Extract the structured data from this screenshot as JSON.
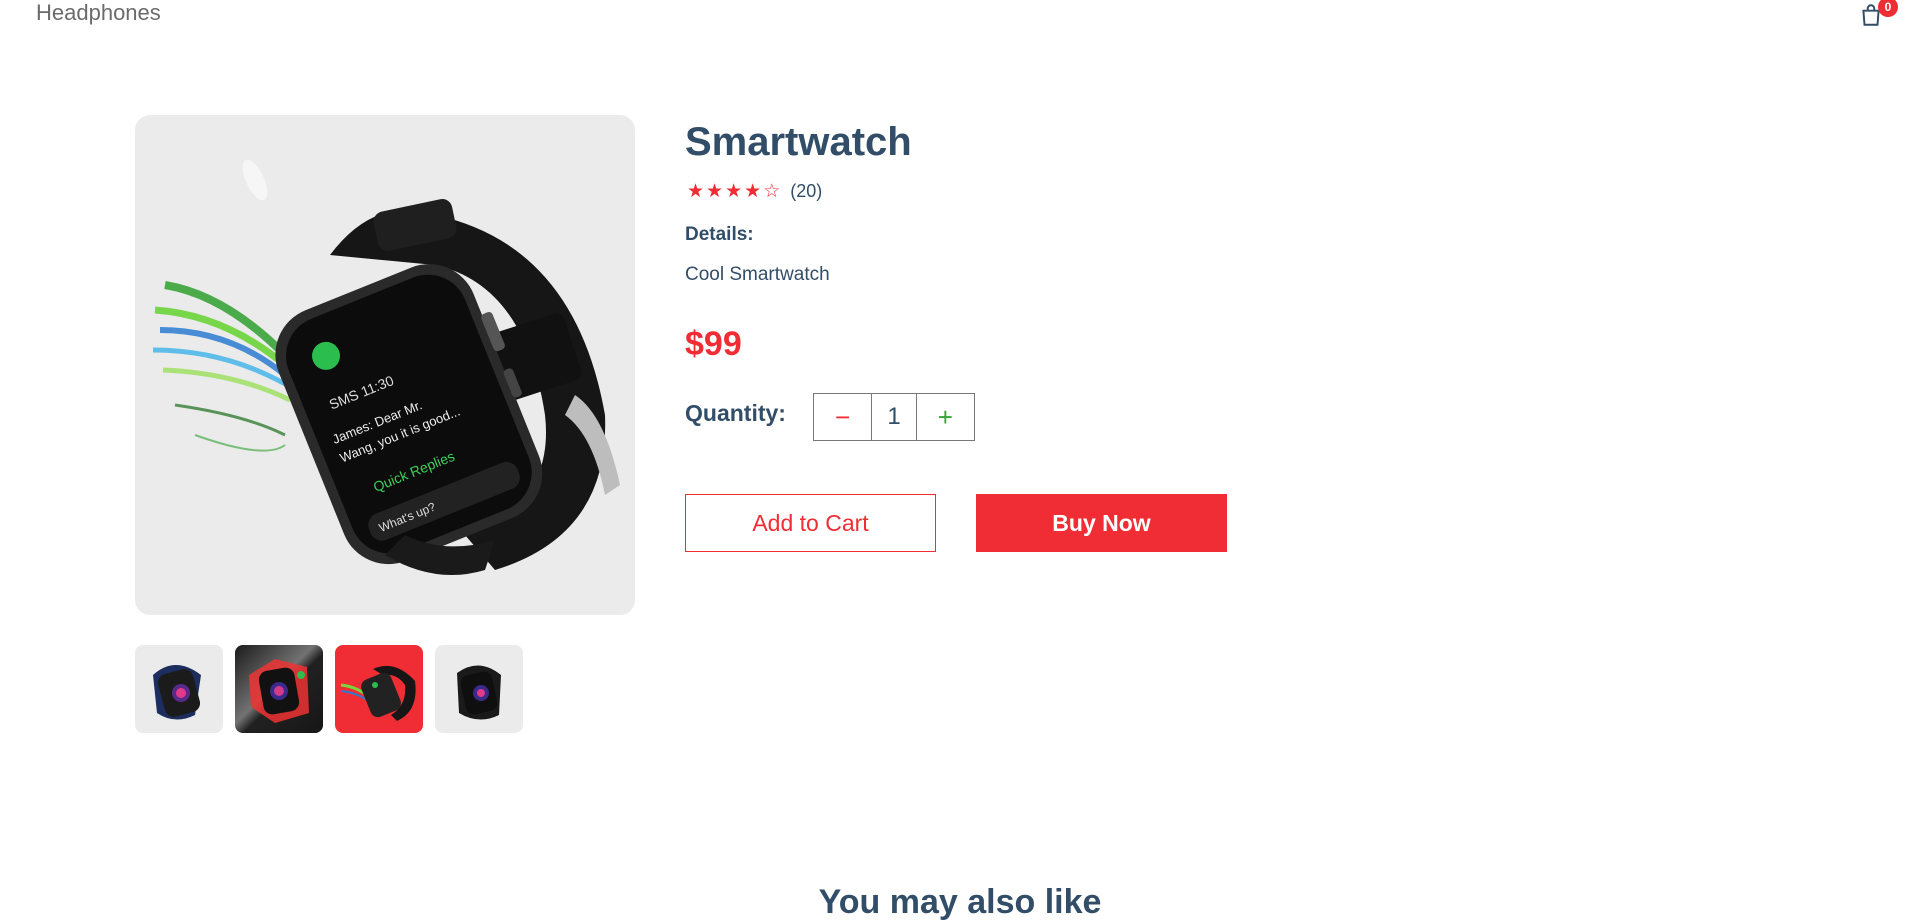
{
  "navbar": {
    "logo": "Headphones",
    "cart_count": "0"
  },
  "product": {
    "name": "Smartwatch",
    "rating": {
      "stars_filled": 4,
      "stars_total": 5,
      "count_text": "(20)"
    },
    "details_label": "Details:",
    "details_text": "Cool Smartwatch",
    "price": "$99",
    "quantity_label": "Quantity:",
    "quantity": "1",
    "add_to_cart_label": "Add to Cart",
    "buy_now_label": "Buy Now",
    "thumbnails_selected_index": 2
  },
  "icons": {
    "cart": "shopping-bag-icon",
    "minus": "minus-icon",
    "plus": "plus-icon",
    "star": "star-icon"
  },
  "colors": {
    "accent": "#f02d34",
    "text": "#324d67",
    "image_bg": "#ebebeb",
    "plus_green": "#31a831"
  },
  "section": {
    "also_like_title": "You may also like"
  }
}
